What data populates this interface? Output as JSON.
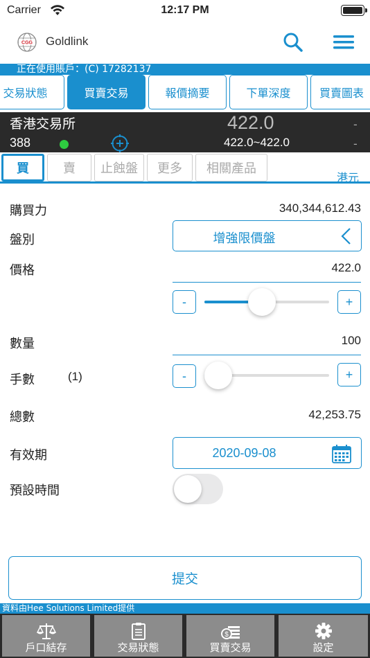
{
  "status_bar": {
    "carrier": "Carrier",
    "time": "12:17 PM"
  },
  "header": {
    "app_name": "Goldlink",
    "logo_text": "CGG"
  },
  "account": {
    "text": "正在使用賬戶：(C) 17282137"
  },
  "main_tabs": [
    {
      "label": "交易狀態"
    },
    {
      "label": "買賣交易"
    },
    {
      "label": "報價摘要"
    },
    {
      "label": "下單深度"
    },
    {
      "label": "買賣圖表"
    }
  ],
  "quote": {
    "exchange": "香港交易所",
    "code": "388",
    "price": "422.0",
    "range": "422.0~422.0",
    "dash1": "-",
    "dash2": "-"
  },
  "sub_tabs": [
    {
      "label": "買"
    },
    {
      "label": "賣"
    },
    {
      "label": "止蝕盤"
    },
    {
      "label": "更多"
    },
    {
      "label": "相關產品"
    }
  ],
  "currency": "港元",
  "form": {
    "buying_power_label": "購買力",
    "buying_power_value": "340,344,612.43",
    "order_type_label": "盤別",
    "order_type_value": "增強限價盤",
    "price_label": "價格",
    "price_value": "422.0",
    "price_slider": 0.46,
    "quantity_label": "數量",
    "quantity_value": "100",
    "lots_label": "手數",
    "lots_value": "(1)",
    "lots_slider": 0.1,
    "total_label": "總數",
    "total_value": "42,253.75",
    "validity_label": "有效期",
    "validity_value": "2020-09-08",
    "preset_time_label": "預設時間",
    "preset_time_on": false,
    "minus": "-",
    "plus": "+"
  },
  "submit_label": "提交",
  "provider_text": "資料由Hee Solutions Limited提供",
  "bottom_nav": [
    {
      "label": "戶口結存",
      "icon": "scale-icon"
    },
    {
      "label": "交易狀態",
      "icon": "clipboard-icon"
    },
    {
      "label": "買賣交易",
      "icon": "money-icon"
    },
    {
      "label": "設定",
      "icon": "gear-icon"
    }
  ],
  "colors": {
    "accent": "#1a8fce",
    "dark": "#2a2a2a",
    "nav_item": "#8c8c8c",
    "online": "#2ecc40"
  }
}
